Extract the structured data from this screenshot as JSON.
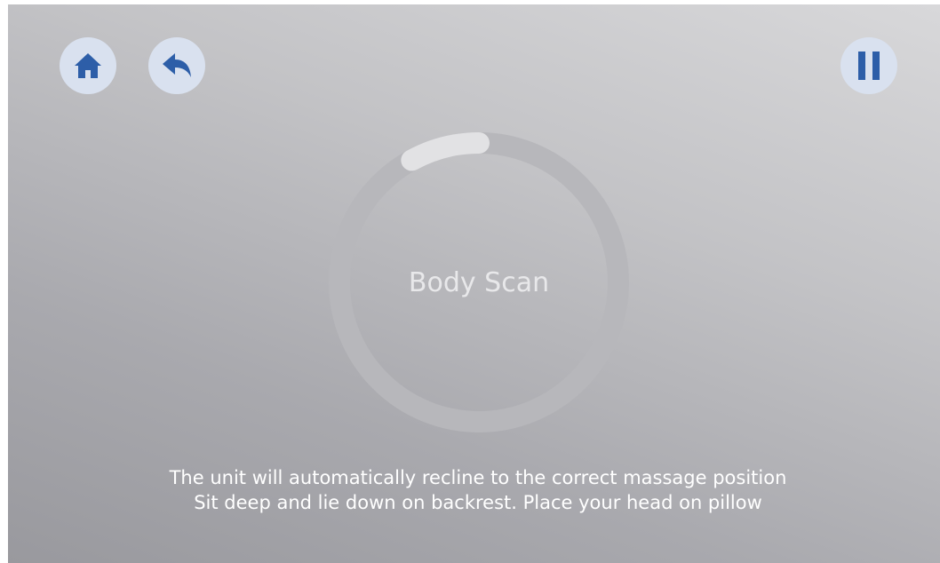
{
  "topbar": {
    "home_icon": "home-icon",
    "back_icon": "back-arrow-icon",
    "pause_icon": "pause-icon",
    "button_bg": "#d9e1ef",
    "icon_color": "#2d5ea8"
  },
  "scan": {
    "title": "Body Scan",
    "progress": 0.08,
    "track_color": "#b7b7bb",
    "progress_color": "#e2e2e4"
  },
  "instructions": {
    "line1": "The unit will automatically recline to the correct massage position",
    "line2": "Sit deep and lie down on backrest.  Place your head on pillow"
  }
}
